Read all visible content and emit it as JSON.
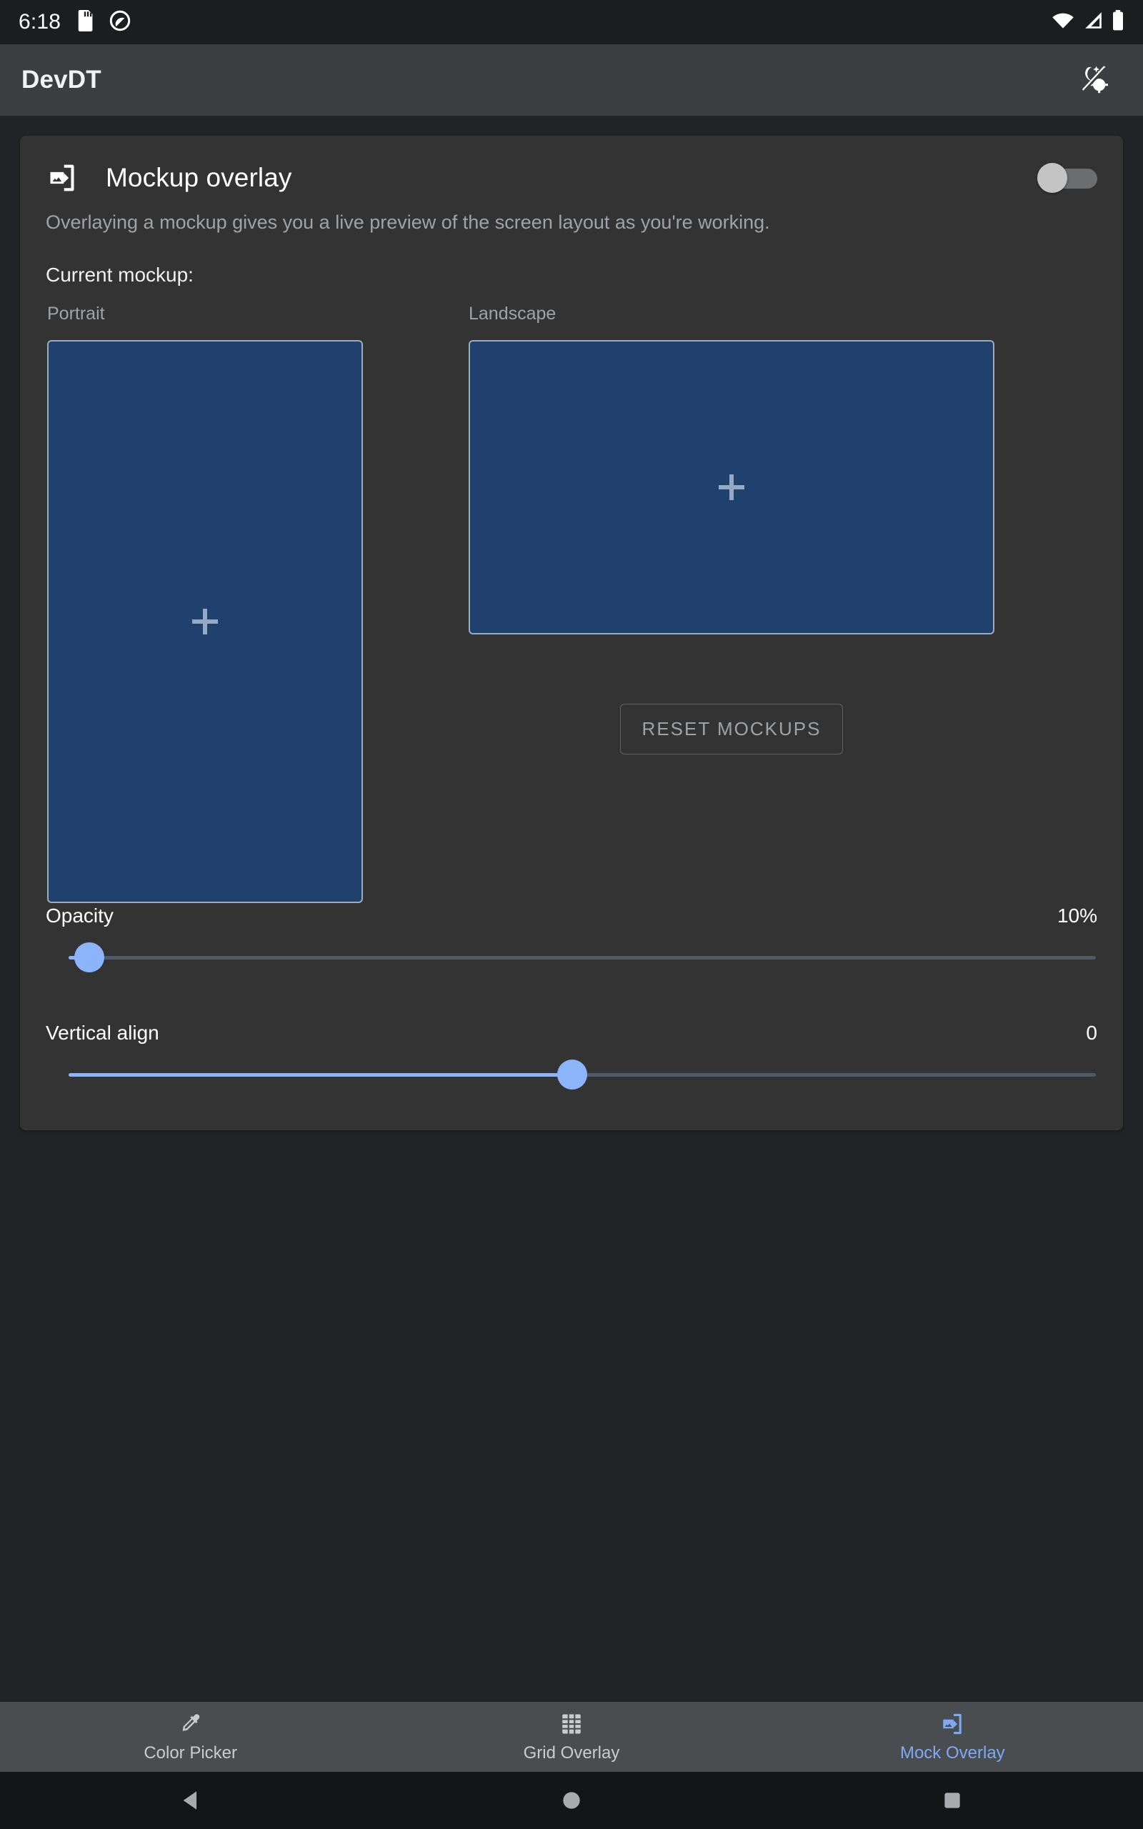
{
  "status_bar": {
    "time": "6:18",
    "left_icons": [
      "sd-card-icon",
      "dnd-circle-icon"
    ],
    "right_icons": [
      "wifi-icon",
      "cell-signal-icon",
      "battery-icon"
    ]
  },
  "app_bar": {
    "title": "DevDT",
    "action_icon": "day-night-theme-toggle-icon"
  },
  "card": {
    "icon": "mockup-overlay-icon",
    "title": "Mockup overlay",
    "subtitle": "Overlaying a mockup gives you a live preview of the screen layout as you're working.",
    "toggle": {
      "name": "mockup-overlay-toggle",
      "state": "off"
    },
    "current_mockup_label": "Current mockup:",
    "portrait": {
      "label": "Portrait",
      "placeholder_icon": "plus-icon",
      "fill_color": "#20406d",
      "border_color": "#9bacbf"
    },
    "landscape": {
      "label": "Landscape",
      "placeholder_icon": "plus-icon",
      "fill_color": "#20406d",
      "border_color": "#9bacbf"
    },
    "reset_button_label": "RESET MOCKUPS",
    "sliders": [
      {
        "name": "opacity-slider",
        "label": "Opacity",
        "value_text": "10%",
        "percent": 2
      },
      {
        "name": "vertical-align-slider",
        "label": "Vertical align",
        "value_text": "0",
        "percent": 49
      }
    ],
    "accent_color": "#8cb4fb"
  },
  "bottom_nav": {
    "items": [
      {
        "label": "Color Picker",
        "icon": "eyedropper-icon",
        "active": false
      },
      {
        "label": "Grid Overlay",
        "icon": "grid-icon",
        "active": false
      },
      {
        "label": "Mock Overlay",
        "icon": "mockup-overlay-icon",
        "active": true
      }
    ],
    "active_color": "#7da9f5"
  },
  "system_nav": {
    "buttons": [
      "back-button",
      "home-button",
      "recents-button"
    ]
  }
}
